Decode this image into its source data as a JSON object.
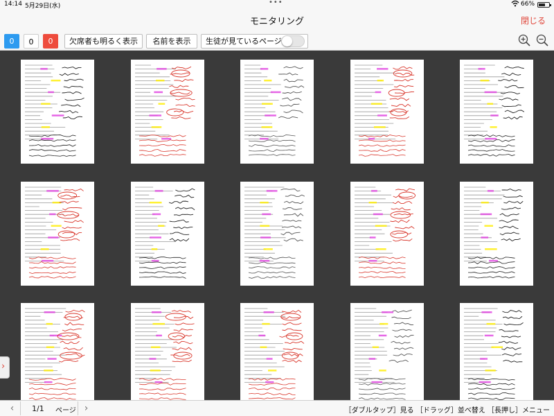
{
  "status": {
    "time": "14:14",
    "date": "5月29日(水)",
    "battery_text": "66%",
    "battery_level": 0.66
  },
  "nav": {
    "title": "モニタリング",
    "close_label": "閉じる"
  },
  "toolbar": {
    "counts": [
      "0",
      "0",
      "0"
    ],
    "show_absent_label": "欠席者も明るく表示",
    "show_names_label": "名前を表示",
    "watched_page_label": "生徒が見ているページ",
    "watched_page_on": false
  },
  "colors": {
    "accent_red": "#e0463a",
    "count_blue": "#2d9bf0",
    "count_red": "#ee4b3c",
    "background": "#3a3a3a",
    "ink_red": "#d9362b",
    "ink_black": "#222222",
    "ink_blue": "#2a3fb0",
    "highlight_yellow": "#ffee00",
    "highlight_magenta": "#e040e0"
  },
  "student_pages": [
    {
      "ink": "black"
    },
    {
      "ink": "red"
    },
    {
      "ink": "pencil"
    },
    {
      "ink": "red"
    },
    {
      "ink": "black"
    },
    {
      "ink": "red"
    },
    {
      "ink": "black"
    },
    {
      "ink": "pencil"
    },
    {
      "ink": "red"
    },
    {
      "ink": "black"
    },
    {
      "ink": "red"
    },
    {
      "ink": "red"
    },
    {
      "ink": "red"
    },
    {
      "ink": "pencil"
    },
    {
      "ink": "black"
    }
  ],
  "pager": {
    "page": "1/1",
    "page_label": "ページ"
  },
  "help_text": "［ダブルタップ］見る ［ドラッグ］並べ替え ［長押し］メニュー",
  "icons": {
    "wifi": "wifi-icon",
    "zoom_in": "zoom-in-icon",
    "zoom_out": "zoom-out-icon",
    "prev": "chevron-left-icon",
    "next": "chevron-right-icon",
    "side": "chevron-right-icon"
  }
}
